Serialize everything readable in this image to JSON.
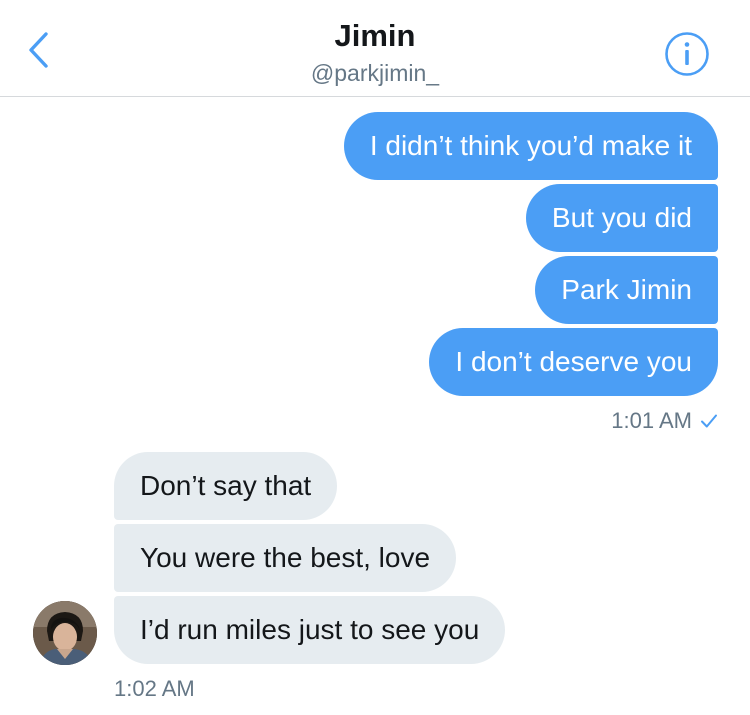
{
  "header": {
    "title": "Jimin",
    "handle": "@parkjimin_",
    "back_icon": "chevron-left-icon",
    "info_icon": "info-icon",
    "accent_color": "#4b9ef5"
  },
  "conversation": {
    "sent_messages": [
      "I didn’t think you’d make it",
      "But you did",
      "Park Jimin",
      "I don’t deserve you"
    ],
    "sent_timestamp": "1:01 AM",
    "sent_status_icon": "checkmark-icon",
    "received_messages": [
      "Don’t say that",
      "You were the best, love",
      "I’d run miles just to see you"
    ],
    "received_timestamp": "1:02 AM",
    "sent_bubble_color": "#4b9ef5",
    "received_bubble_color": "#e6ecf0"
  }
}
